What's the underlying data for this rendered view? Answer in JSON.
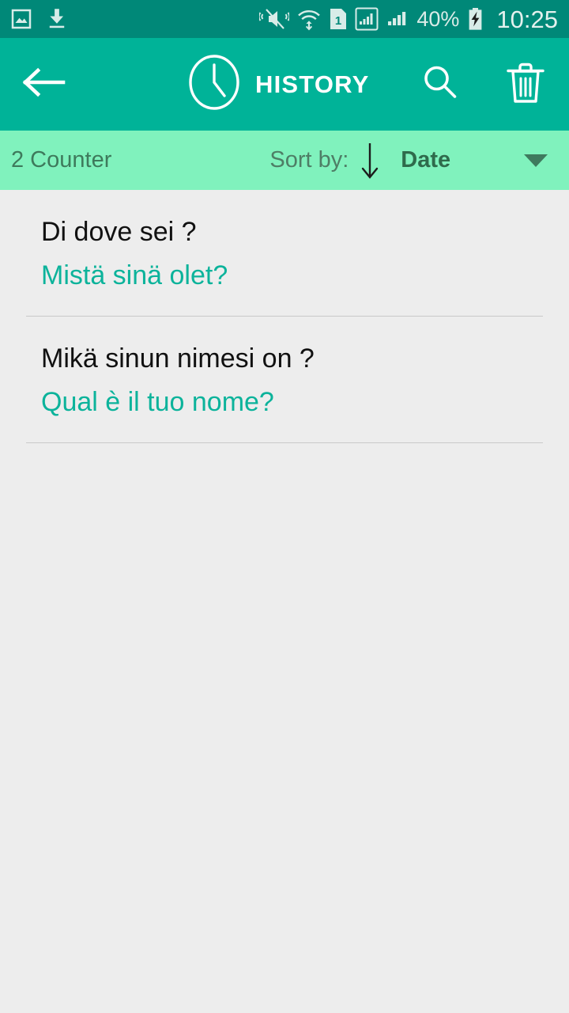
{
  "status_bar": {
    "left_icons": [
      "image-icon",
      "download-icon"
    ],
    "right_icons": [
      "mute-vibrate-icon",
      "wifi-icon",
      "sim-1-icon",
      "signal-boxed-icon",
      "signal-bars-icon"
    ],
    "battery_percent": "40%",
    "battery_icon": "battery-charging-icon",
    "clock": "10:25",
    "background": "#008878"
  },
  "app_bar": {
    "back_icon": "arrow-left-icon",
    "clock_icon": "clock-icon",
    "title": "HISTORY",
    "search_icon": "search-icon",
    "delete_icon": "trash-icon",
    "background": "#00b398"
  },
  "sort_bar": {
    "counter": "2 Counter",
    "sort_by_label": "Sort by:",
    "sort_direction_icon": "arrow-down-icon",
    "sort_value": "Date",
    "dropdown_icon": "triangle-down-icon",
    "background": "#80f2bd"
  },
  "history": {
    "items": [
      {
        "source": "Di dove sei ?",
        "translation": "Mistä sinä olet?"
      },
      {
        "source": "Mikä sinun nimesi on ?",
        "translation": "Qual è il tuo nome?"
      }
    ]
  },
  "colors": {
    "page_background": "#ededed",
    "accent_teal": "#0cb39b",
    "source_text": "#111111"
  }
}
